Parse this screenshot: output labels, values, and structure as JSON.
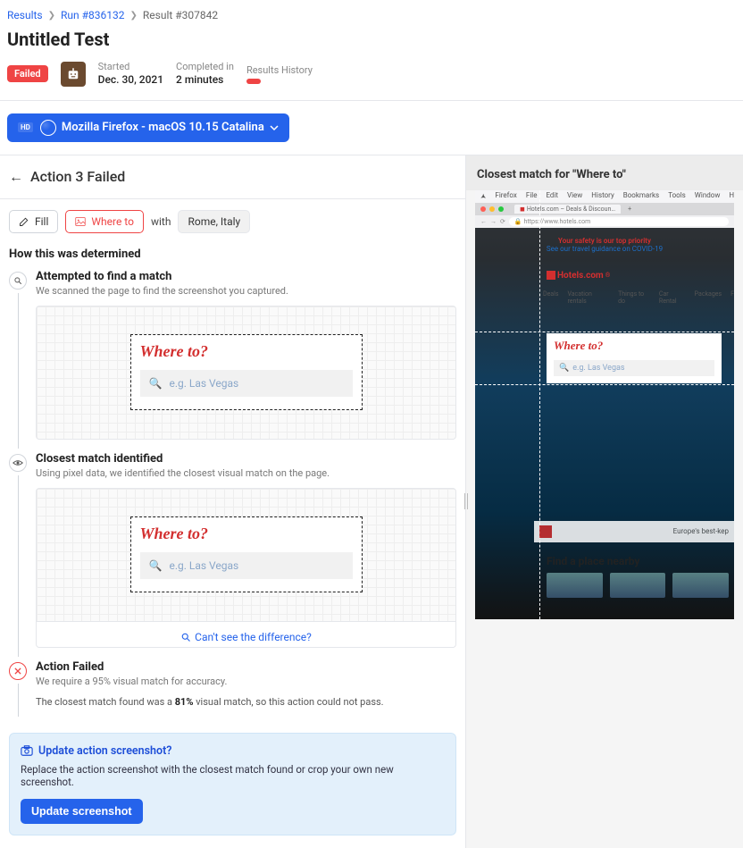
{
  "breadcrumb": {
    "results": "Results",
    "run_prefix": "Run #",
    "run_number": "836132",
    "result": "Result #307842"
  },
  "title": "Untitled Test",
  "meta": {
    "failed": "Failed",
    "started_label": "Started",
    "started_value": "Dec. 30, 2021",
    "completed_label": "Completed in",
    "completed_value": "2 minutes",
    "history_label": "Results History"
  },
  "browser": {
    "hd": "HD",
    "label": "Mozilla Firefox - macOS 10.15 Catalina"
  },
  "action": {
    "title": "Action 3 Failed",
    "fill": "Fill",
    "target": "Where to",
    "with": "with",
    "value": "Rome, Italy"
  },
  "determined": "How this was determined",
  "step1": {
    "title": "Attempted to find a match",
    "sub": "We scanned the page to find the screenshot you captured."
  },
  "step2": {
    "title": "Closest match identified",
    "sub": "Using pixel data, we identified the closest visual match on the page.",
    "diff_link": "Can't see the difference?"
  },
  "step3": {
    "title": "Action Failed",
    "sub": "We require a 95% visual match for accuracy.",
    "closest_pre": "The closest match found was a ",
    "closest_pct": "81%",
    "closest_post": " visual match, so this action could not pass."
  },
  "shot": {
    "headline": "Where to?",
    "placeholder": "e.g. Las Vegas"
  },
  "update": {
    "head": "Update action screenshot?",
    "sub": "Replace the action screenshot with the closest match found or crop your own new screenshot.",
    "button": "Update screenshot"
  },
  "right": {
    "header": "Closest match for \"Where to\""
  },
  "preview": {
    "menu": [
      "Firefox",
      "File",
      "Edit",
      "View",
      "History",
      "Bookmarks",
      "Tools",
      "Window",
      "Help"
    ],
    "tab": "Hotels.com – Deals & Discoun…",
    "url": "https://www.hotels.com",
    "banner1": "Your safety is our top priority",
    "banner2": "See our travel guidance on COVID-19",
    "logo": "Hotels.com",
    "nav": [
      "Deals",
      "Vacation rentals",
      "Things to do",
      "Car Rental",
      "Packages",
      "F"
    ],
    "headline": "Where to?",
    "placeholder": "e.g. Las Vegas",
    "search_tail": "Europe's best-kep",
    "nearby": "Find a place nearby"
  }
}
